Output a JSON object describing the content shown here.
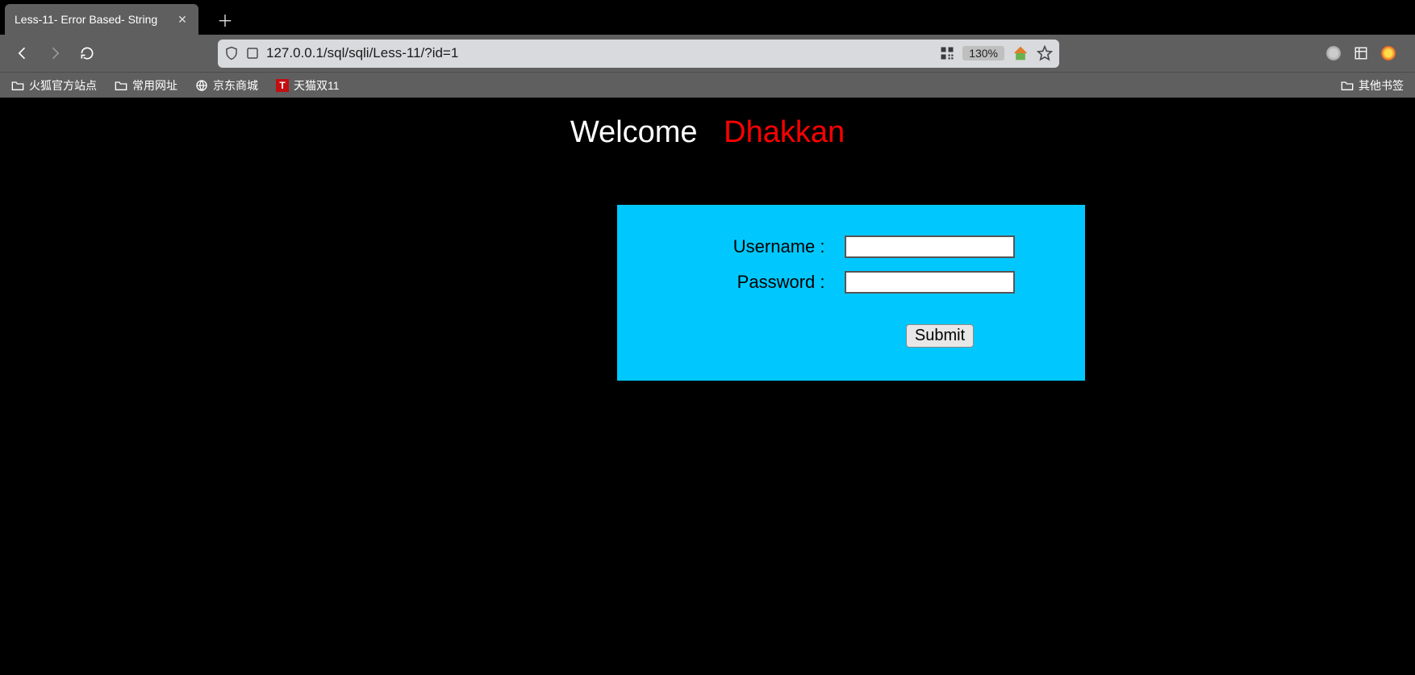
{
  "tab": {
    "title": "Less-11- Error Based- String"
  },
  "nav": {
    "url": "127.0.0.1/sql/sqli/Less-11/?id=1",
    "zoom": "130%"
  },
  "bookmarks": {
    "items": [
      {
        "label": "火狐官方站点"
      },
      {
        "label": "常用网址"
      },
      {
        "label": "京东商城"
      },
      {
        "label": "天猫双11"
      }
    ],
    "right": "其他书签"
  },
  "page": {
    "welcome": "Welcome",
    "name": "Dhakkan",
    "form": {
      "username_label": "Username :",
      "password_label": "Password :",
      "username_value": "",
      "password_value": "",
      "submit_label": "Submit"
    }
  }
}
